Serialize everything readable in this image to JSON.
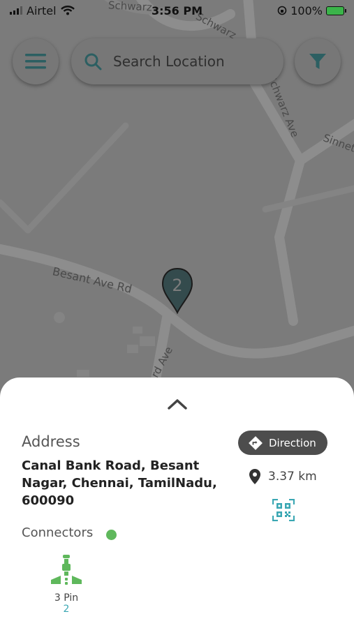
{
  "status_bar": {
    "carrier": "Airtel",
    "time": "3:56 PM",
    "battery_percent": "100%"
  },
  "header": {
    "search_placeholder": "Search Location",
    "menu_icon": "hamburger-menu-icon",
    "filter_icon": "filter-icon"
  },
  "map": {
    "road_labels": [
      "Schwarz",
      "Schwarz",
      "Schwarz Ave",
      "Sinnet",
      "Besant Ave Rd",
      "rd Ave"
    ],
    "cluster_pin_count": "2"
  },
  "details": {
    "address_label": "Address",
    "address": "Canal Bank Road, Besant Nagar, Chennai, TamilNadu, 600090",
    "direction_label": "Direction",
    "distance": "3.37 km",
    "connectors_label": "Connectors",
    "availability_color": "#5fb85c",
    "connectors": [
      {
        "name": "3 Pin",
        "count": "2"
      }
    ]
  },
  "colors": {
    "accent": "#3a6f72",
    "teal": "#3aa7b3",
    "available": "#5fb85c"
  }
}
